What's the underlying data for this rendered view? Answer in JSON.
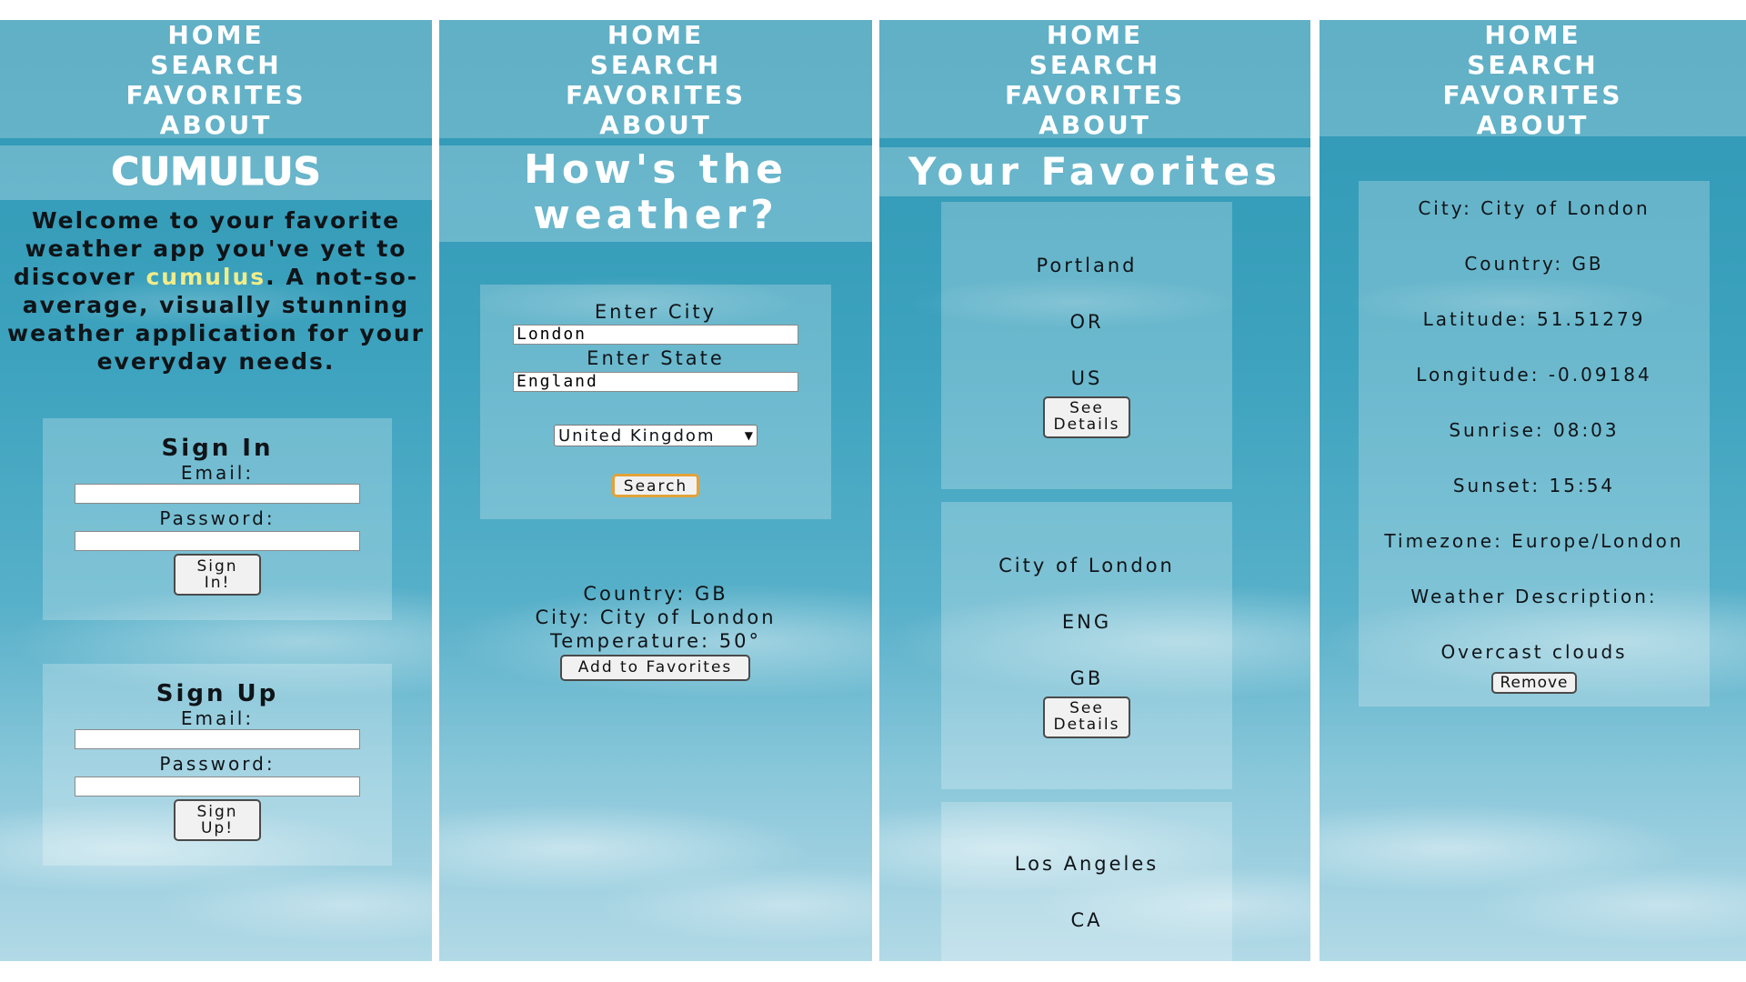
{
  "nav": {
    "home": "HOME",
    "search": "SEARCH",
    "favorites": "FAVORITES",
    "about": "ABOUT"
  },
  "home_screen": {
    "logo": "CUMULUS",
    "welcome_before": "Welcome to your favorite weather app you've yet to discover ",
    "welcome_brand": "cumulus",
    "welcome_after": ". A not-so-average, visually stunning weather application for your everyday needs.",
    "sign_in": {
      "title": "Sign In",
      "email_label": "Email:",
      "password_label": "Password:",
      "button_line1": "Sign",
      "button_line2": "In!"
    },
    "sign_up": {
      "title": "Sign Up",
      "email_label": "Email:",
      "password_label": "Password:",
      "button_line1": "Sign",
      "button_line2": "Up!"
    }
  },
  "search_screen": {
    "title_line1": "How's the",
    "title_line2": "weather?",
    "city_label": "Enter City",
    "city_value": "London",
    "state_label": "Enter State",
    "state_value": "England",
    "country_selected": "United Kingdom",
    "search_button": "Search",
    "result_country": "Country: GB",
    "result_city": "City: City of London",
    "result_temperature": "Temperature: 50°",
    "add_favorites_button": "Add to Favorites"
  },
  "favorites_screen": {
    "title": "Your Favorites",
    "items": [
      {
        "city": "Portland",
        "state": "OR",
        "country": "US",
        "button_line1": "See",
        "button_line2": "Details"
      },
      {
        "city": "City of London",
        "state": "ENG",
        "country": "GB",
        "button_line1": "See",
        "button_line2": "Details"
      },
      {
        "city": "Los Angeles",
        "state": "CA"
      }
    ]
  },
  "details_screen": {
    "city": "City: City of London",
    "country": "Country: GB",
    "latitude": "Latitude: 51.51279",
    "longitude": "Longitude: -0.09184",
    "sunrise": "Sunrise: 08:03",
    "sunset": "Sunset: 15:54",
    "timezone": "Timezone: Europe/London",
    "weather_label": "Weather Description:",
    "weather_value": "Overcast clouds",
    "remove_button": "Remove"
  },
  "colors": {
    "brand_highlight": "#f1ec8a",
    "sky_blue": "#3ca2be",
    "search_button_border": "#e2a23a"
  }
}
